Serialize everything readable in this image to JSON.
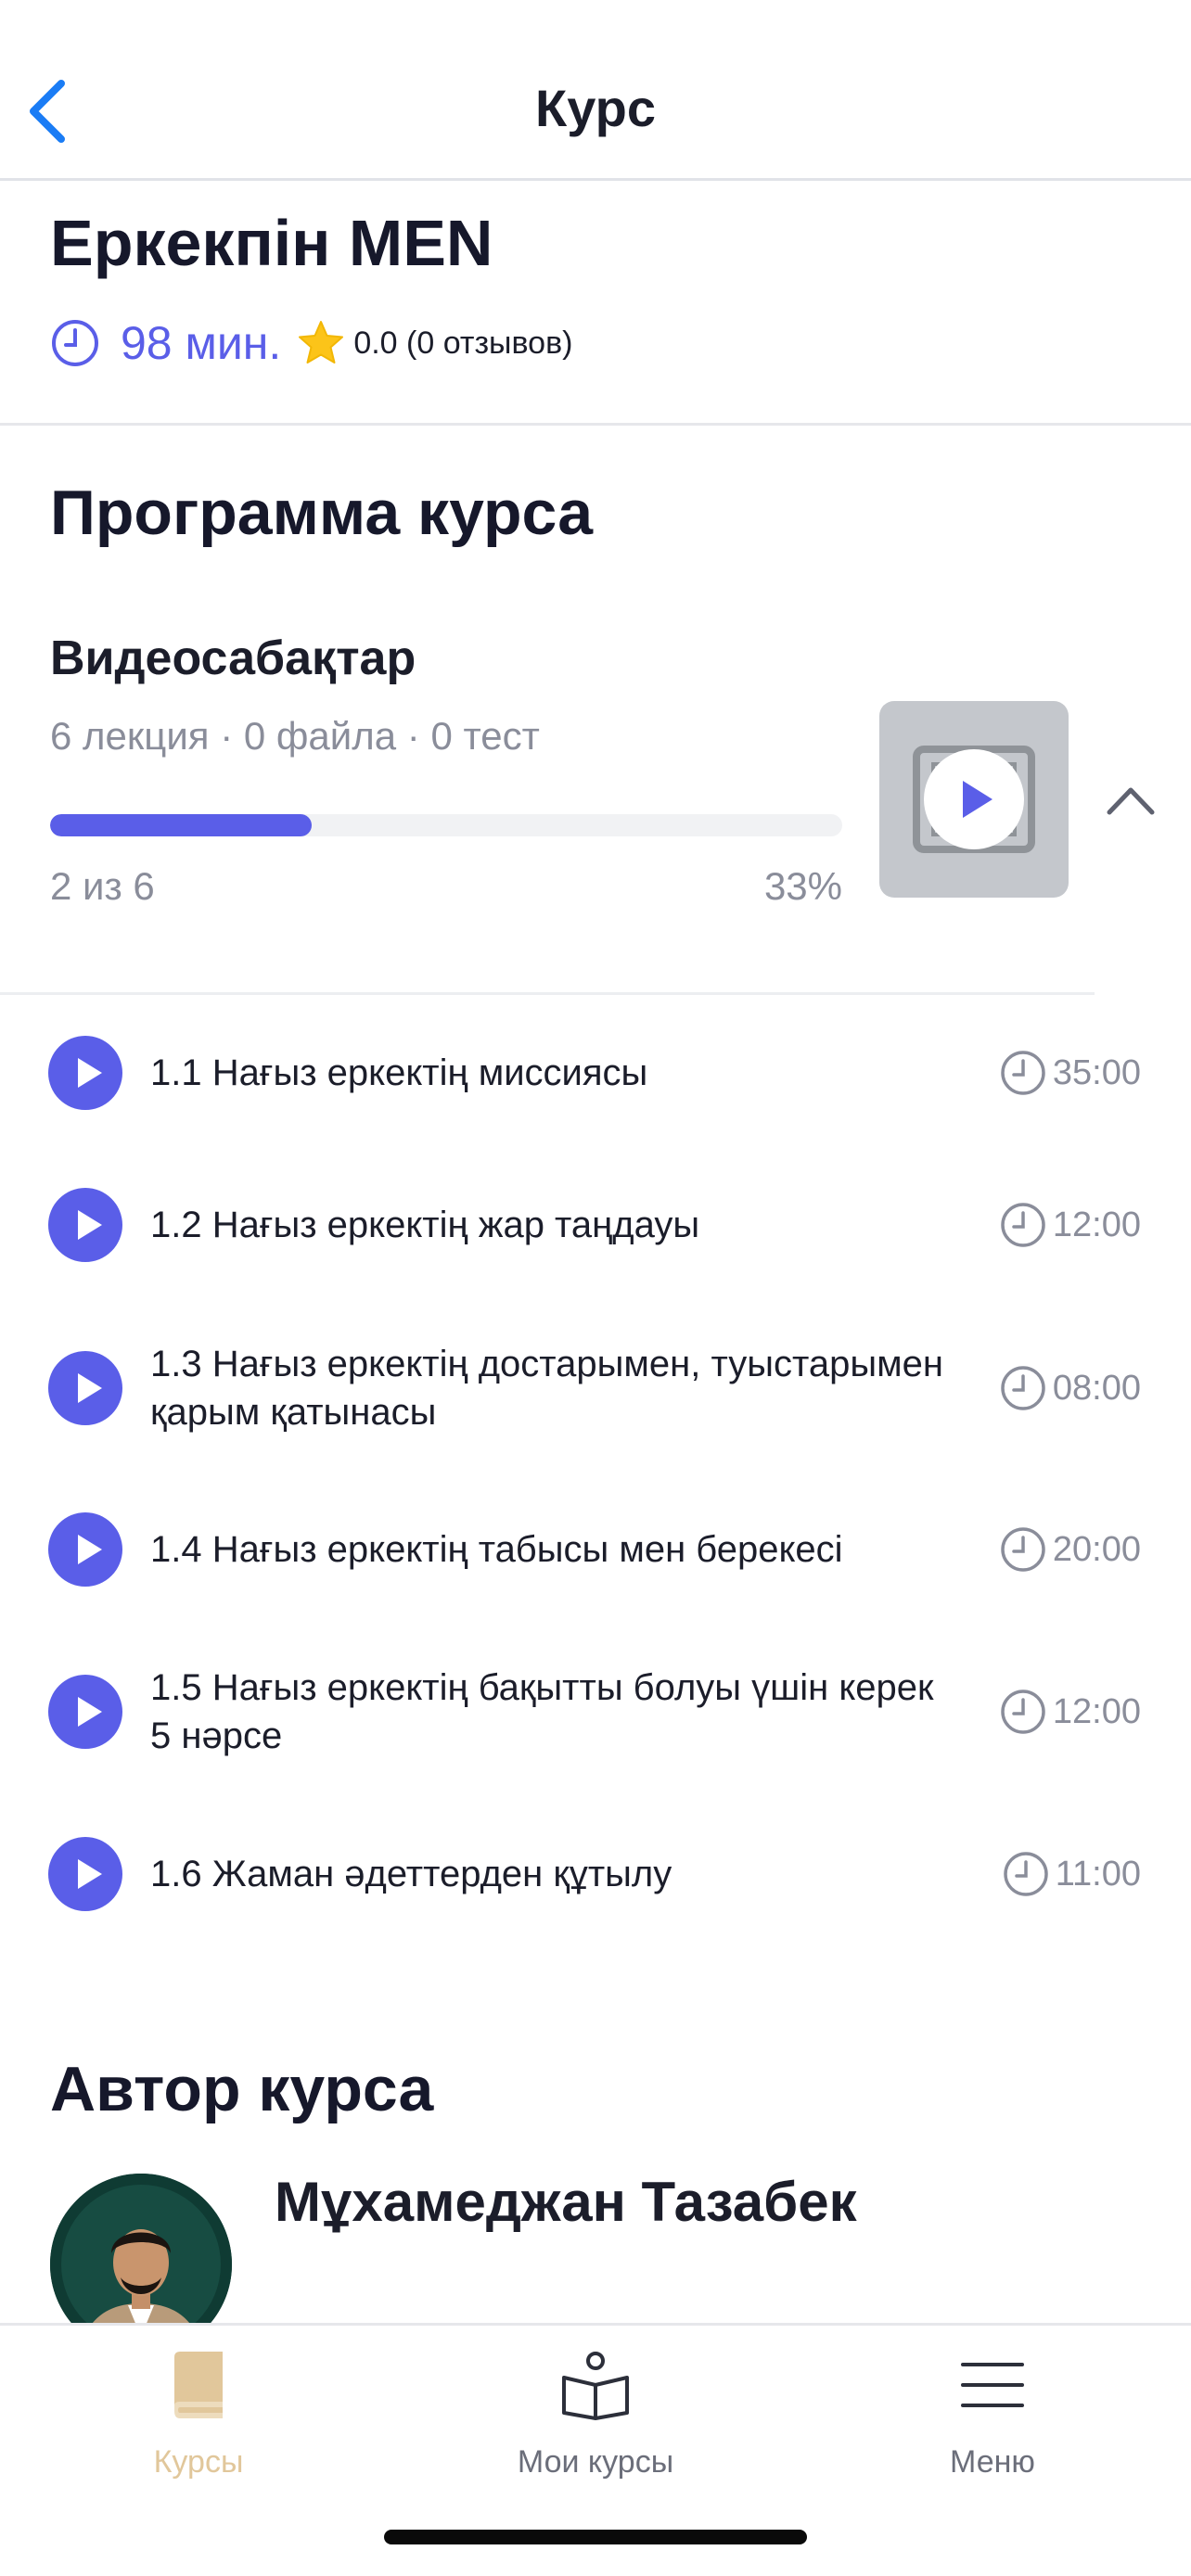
{
  "header": {
    "title": "Курс"
  },
  "course": {
    "title": "Еркекпін MEN",
    "duration": "98 мин.",
    "rating": "0.0 (0 отзывов)"
  },
  "program": {
    "section_title": "Программа курса",
    "block_title": "Видеосабақтар",
    "block_meta": "6 лекция · 0 файла · 0 тест",
    "progress_fraction": 0.33,
    "progress_count": "2 из 6",
    "progress_percent": "33%"
  },
  "lessons": [
    {
      "title": "1.1 Нағыз еркектің миссиясы",
      "duration": "35:00"
    },
    {
      "title": "1.2 Нағыз еркектің жар таңдауы",
      "duration": "12:00"
    },
    {
      "title": "1.3 Нағыз еркектің достарымен, туыстарымен қарым қатынасы",
      "duration": "08:00"
    },
    {
      "title": "1.4 Нағыз еркектің табысы мен берекесі",
      "duration": "20:00"
    },
    {
      "title": "1.5 Нағыз еркектің бақытты болуы үшін керек 5 нәрсе",
      "duration": "12:00"
    },
    {
      "title": "1.6 Жаман әдеттерден құтылу",
      "duration": "11:00"
    }
  ],
  "author": {
    "section_title": "Автор курса",
    "name": "Мұхамеджан Тазабек"
  },
  "tabbar": {
    "courses_label": "Курсы",
    "my_courses_label": "Мои курсы",
    "menu_label": "Меню"
  },
  "colors": {
    "accent": "#5a5ee8",
    "ios_blue": "#1a7cf5",
    "star": "#fcc419",
    "tab_active": "#e1c79b",
    "muted": "#8a8d9a"
  },
  "icons": {
    "back": "chevron-left-icon",
    "duration": "clock-icon",
    "rating": "star-icon",
    "lesson": "play-circle-icon",
    "collapse": "chevron-up-icon",
    "tab_courses": "book-icon",
    "tab_my_courses": "reading-person-icon",
    "tab_menu": "hamburger-icon"
  }
}
